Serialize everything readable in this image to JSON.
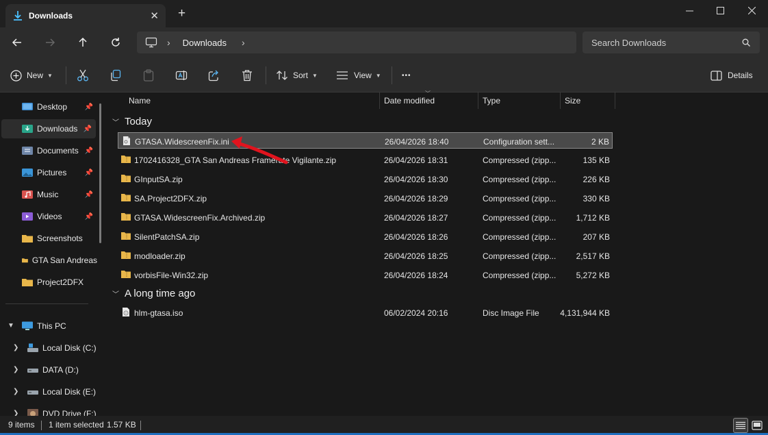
{
  "window": {
    "tab_title": "Downloads",
    "tab_close": "✕",
    "new_tab": "+",
    "minimize": "─",
    "maximize": "☐",
    "close": "✕"
  },
  "address": {
    "breadcrumb": "Downloads",
    "separator": "›",
    "search_placeholder": "Search Downloads"
  },
  "toolbar": {
    "new_label": "New",
    "sort_label": "Sort",
    "view_label": "View",
    "more_label": "•••",
    "details_label": "Details"
  },
  "sidebar": {
    "quick_access": [
      {
        "label": "Desktop",
        "icon": "desktop-icon",
        "pinned": true
      },
      {
        "label": "Downloads",
        "icon": "downloads-icon",
        "pinned": true,
        "active": true
      },
      {
        "label": "Documents",
        "icon": "documents-icon",
        "pinned": true
      },
      {
        "label": "Pictures",
        "icon": "pictures-icon",
        "pinned": true
      },
      {
        "label": "Music",
        "icon": "music-icon",
        "pinned": true
      },
      {
        "label": "Videos",
        "icon": "videos-icon",
        "pinned": true
      },
      {
        "label": "Screenshots",
        "icon": "folder-icon",
        "pinned": false
      },
      {
        "label": "GTA San Andreas",
        "icon": "folder-icon",
        "pinned": false
      },
      {
        "label": "Project2DFX",
        "icon": "folder-icon",
        "pinned": false
      }
    ],
    "this_pc": "This PC",
    "drives": [
      {
        "label": "Local Disk (C:)",
        "icon": "system-drive-icon"
      },
      {
        "label": "DATA (D:)",
        "icon": "drive-icon"
      },
      {
        "label": "Local Disk (E:)",
        "icon": "drive-icon"
      },
      {
        "label": "DVD Drive (F:)",
        "icon": "dvd-drive-icon"
      }
    ]
  },
  "columns": {
    "name": "Name",
    "date": "Date modified",
    "type": "Type",
    "size": "Size"
  },
  "groups": [
    {
      "label": "Today",
      "files": [
        {
          "name": "GTASA.WidescreenFix.ini",
          "date": "26/04/2026 18:40",
          "type": "Configuration sett...",
          "size": "2 KB",
          "icon": "ini-file-icon",
          "selected": true
        },
        {
          "name": "1702416328_GTA San Andreas Framerate Vigilante.zip",
          "date": "26/04/2026 18:31",
          "type": "Compressed (zipp...",
          "size": "135 KB",
          "icon": "zip-folder-icon"
        },
        {
          "name": "GInputSA.zip",
          "date": "26/04/2026 18:30",
          "type": "Compressed (zipp...",
          "size": "226 KB",
          "icon": "zip-folder-icon"
        },
        {
          "name": "SA.Project2DFX.zip",
          "date": "26/04/2026 18:29",
          "type": "Compressed (zipp...",
          "size": "330 KB",
          "icon": "zip-folder-icon"
        },
        {
          "name": "GTASA.WidescreenFix.Archived.zip",
          "date": "26/04/2026 18:27",
          "type": "Compressed (zipp...",
          "size": "1,712 KB",
          "icon": "zip-folder-icon"
        },
        {
          "name": "SilentPatchSA.zip",
          "date": "26/04/2026 18:26",
          "type": "Compressed (zipp...",
          "size": "207 KB",
          "icon": "zip-folder-icon"
        },
        {
          "name": "modloader.zip",
          "date": "26/04/2026 18:25",
          "type": "Compressed (zipp...",
          "size": "2,517 KB",
          "icon": "zip-folder-icon"
        },
        {
          "name": "vorbisFile-Win32.zip",
          "date": "26/04/2026 18:24",
          "type": "Compressed (zipp...",
          "size": "5,272 KB",
          "icon": "zip-folder-icon"
        }
      ]
    },
    {
      "label": "A long time ago",
      "files": [
        {
          "name": "hlm-gtasa.iso",
          "date": "06/02/2024 20:16",
          "type": "Disc Image File",
          "size": "4,131,944 KB",
          "icon": "disc-image-icon"
        }
      ]
    }
  ],
  "status": {
    "item_count": "9 items",
    "selection": "1 item selected",
    "selection_size": "1.57 KB"
  },
  "colors": {
    "annotation_arrow": "#e0141e",
    "folder": "#e8b64a",
    "accent": "#4cc2ff"
  }
}
